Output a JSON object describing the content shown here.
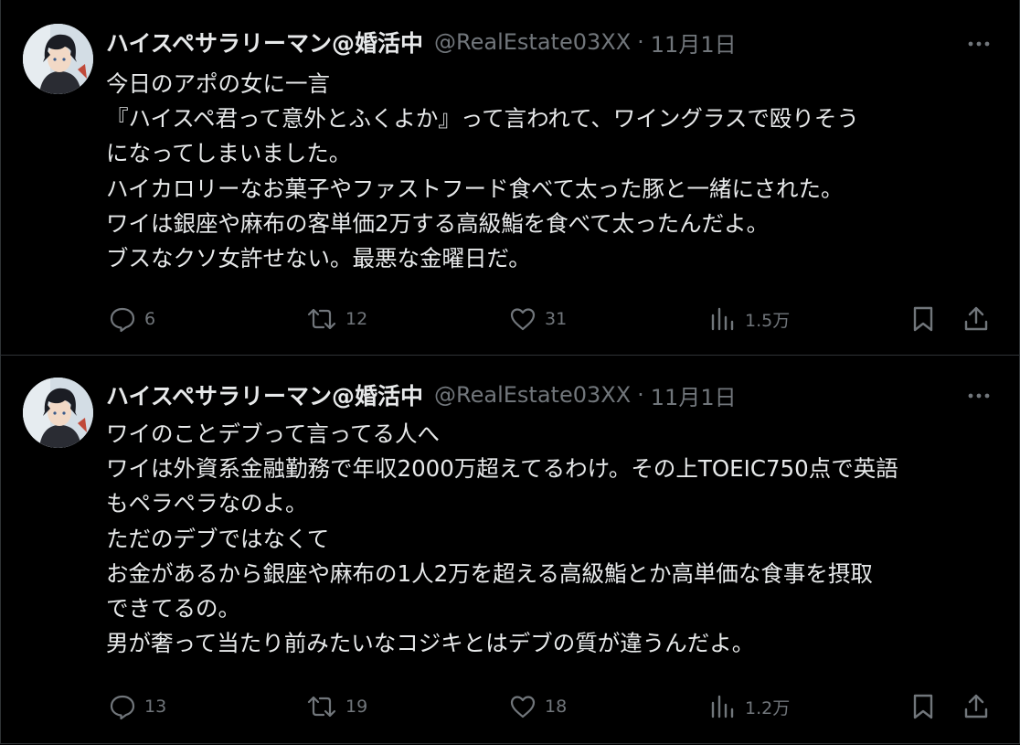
{
  "tweets": [
    {
      "display_name": "ハイスペサラリーマン@婚活中",
      "handle": "@RealEstate03XX",
      "separator": "·",
      "date": "11月1日",
      "lines": [
        "今日のアポの女に一言",
        "『ハイスペ君って意外とふくよか』って言われて、ワイングラスで殴りそう",
        "になってしまいました。",
        "ハイカロリーなお菓子やファストフード食べて太った豚と一緒にされた。",
        "ワイは銀座や麻布の客単価2万する高級鮨を食べて太ったんだよ。",
        "ブスなクソ女許せない。最悪な金曜日だ。"
      ],
      "replies": "6",
      "retweets": "12",
      "likes": "31",
      "views": "1.5万"
    },
    {
      "display_name": "ハイスペサラリーマン@婚活中",
      "handle": "@RealEstate03XX",
      "separator": "·",
      "date": "11月1日",
      "lines": [
        "ワイのことデブって言ってる人へ",
        "ワイは外資系金融勤務で年収2000万超えてるわけ。その上TOEIC750点で英語",
        "もペラペラなのよ。",
        "ただのデブではなくて",
        "お金があるから銀座や麻布の1人2万を超える高級鮨とか高単価な食事を摂取",
        "できてるの。",
        "男が奢って当たり前みたいなコジキとはデブの質が違うんだよ。"
      ],
      "replies": "13",
      "retweets": "19",
      "likes": "18",
      "views": "1.2万"
    }
  ],
  "icons": {
    "more": "more-horizontal-icon",
    "reply": "speech-bubble-icon",
    "retweet": "retweet-arrows-icon",
    "like": "heart-icon",
    "views": "bar-chart-icon",
    "bookmark": "bookmark-icon",
    "share": "share-upload-icon"
  },
  "colors": {
    "background": "#000000",
    "text": "#e7e9ea",
    "secondary": "#71767b",
    "divider": "#2f3336"
  }
}
